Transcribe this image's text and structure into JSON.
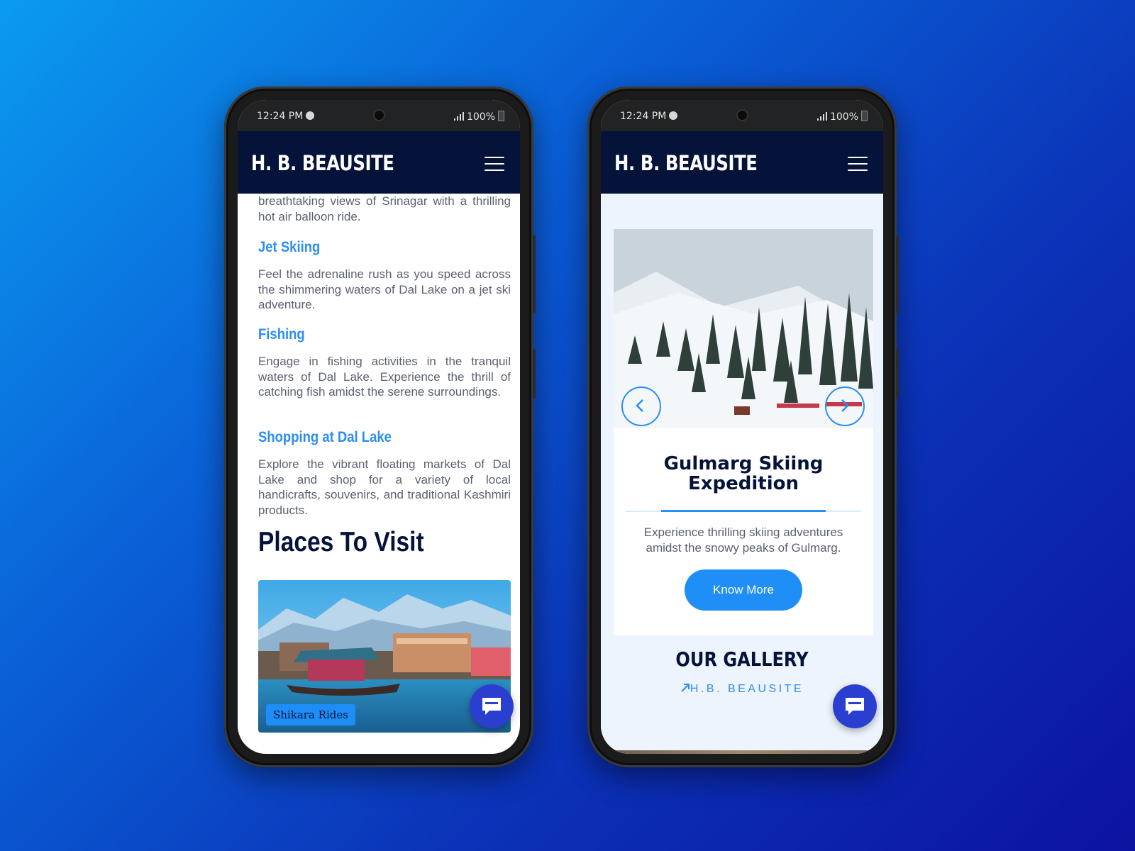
{
  "status_bar": {
    "time": "12:24 PM",
    "battery": "100%"
  },
  "brand": {
    "logo": "H. B. BEAUSITE"
  },
  "left_phone": {
    "balloon_text": "breathtaking views of Srinagar with a thrilling hot air balloon ride.",
    "activities": [
      {
        "title": "Jet Skiing",
        "text": "Feel the adrenaline rush as you speed across the shimmering waters of Dal Lake on a jet ski adventure."
      },
      {
        "title": "Fishing",
        "text": "Engage in fishing activities in the tranquil waters of Dal Lake. Experience the thrill of catching fish amidst the serene surroundings."
      },
      {
        "title": "Shopping at Dal Lake",
        "text": "Explore the vibrant floating markets of Dal Lake and shop for a variety of local handicrafts, souvenirs, and traditional Kashmiri products."
      }
    ],
    "places_heading": "Places To Visit",
    "place_card_label": "Shikara Rides"
  },
  "right_phone": {
    "slide_title": "Gulmarg Skiing Expedition",
    "slide_description": "Experience thrilling skiing adventures amidst the snowy peaks of Gulmarg.",
    "know_more_label": "Know More",
    "gallery_heading": "OUR GALLERY",
    "gallery_subtitle": "H.B. BEAUSITE"
  },
  "colors": {
    "navy": "#05133b",
    "accent_blue": "#2a8df2",
    "chat_button": "#2a3fd0"
  },
  "icons": [
    "menu-icon",
    "chat-icon",
    "chevron-left-icon",
    "chevron-right-icon",
    "arrow-up-right-icon",
    "signal-icon",
    "battery-icon",
    "spotify-icon"
  ]
}
